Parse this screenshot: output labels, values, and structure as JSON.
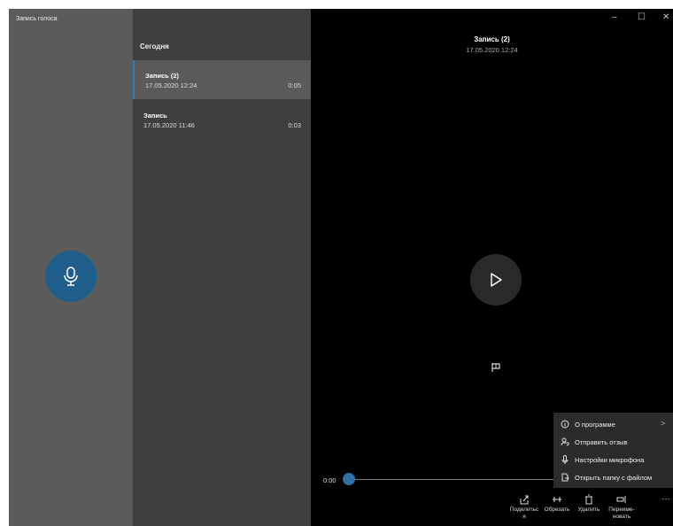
{
  "app": {
    "title": "Запись голоса"
  },
  "list": {
    "section": "Сегодня",
    "items": [
      {
        "name": "Запись (2)",
        "date": "17.05.2020 12:24",
        "duration": "0:05"
      },
      {
        "name": "Запись",
        "date": "17.05.2020 11:46",
        "duration": "0:03"
      }
    ]
  },
  "window_controls": {
    "minimize": "–",
    "maximize": "☐",
    "close": "✕"
  },
  "player": {
    "title": "Запись (2)",
    "date": "17.05.2020 12:24",
    "position": "0:00",
    "progress": 0
  },
  "toolbar": {
    "share": "Поделитьс\nя",
    "trim": "Обрезать",
    "delete": "Удалить",
    "rename": "Переиме-\nновать",
    "more": "···"
  },
  "menu": {
    "items": [
      {
        "label": "О программе",
        "icon": "info-icon"
      },
      {
        "label": "Отправить отзыв",
        "icon": "feedback-icon"
      },
      {
        "label": "Настройки микрофона",
        "icon": "microphone-icon"
      },
      {
        "label": "Открыть папку с файлом",
        "icon": "file-folder-icon"
      }
    ],
    "submenu_arrow": ">"
  },
  "colors": {
    "accent": "#1f5d8b",
    "left_pane": "#5b5b5b",
    "list_pane": "#3f3f3f",
    "player_bg": "#000000"
  }
}
